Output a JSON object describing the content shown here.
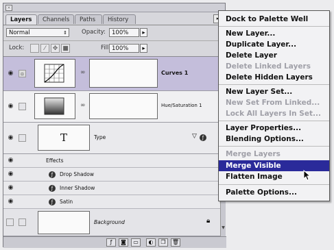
{
  "palette": {
    "tabs": [
      "Layers",
      "Channels",
      "Paths",
      "History"
    ],
    "blend_mode": "Normal",
    "opacity_label": "Opacity:",
    "opacity_value": "100%",
    "lock_label": "Lock:",
    "fill_label": "Fill:",
    "fill_value": "100%"
  },
  "layers": [
    {
      "name": "Curves 1",
      "selected": true
    },
    {
      "name": "Hue/Saturation 1",
      "selected": false
    },
    {
      "name": "Type",
      "thumb": "T",
      "selected": false
    },
    {
      "name": "Background",
      "selected": false
    }
  ],
  "effects": {
    "header": "Effects",
    "items": [
      "Drop Shadow",
      "Inner Shadow",
      "Satin"
    ]
  },
  "menu": {
    "items": [
      {
        "label": "Dock to Palette Well",
        "enabled": true
      },
      {
        "label": "New Layer...",
        "enabled": true
      },
      {
        "label": "Duplicate Layer...",
        "enabled": true
      },
      {
        "label": "Delete Layer",
        "enabled": true
      },
      {
        "label": "Delete Linked Layers",
        "enabled": false
      },
      {
        "label": "Delete Hidden Layers",
        "enabled": true
      },
      {
        "label": "New Layer Set...",
        "enabled": true
      },
      {
        "label": "New Set From Linked...",
        "enabled": false
      },
      {
        "label": "Lock All Layers In Set...",
        "enabled": false
      },
      {
        "label": "Layer Properties...",
        "enabled": true
      },
      {
        "label": "Blending Options...",
        "enabled": true
      },
      {
        "label": "Merge Layers",
        "enabled": false
      },
      {
        "label": "Merge Visible",
        "enabled": true,
        "highlighted": true
      },
      {
        "label": "Flatten Image",
        "enabled": true
      },
      {
        "label": "Palette Options...",
        "enabled": true
      }
    ]
  },
  "colors": {
    "selection": "#c4bedb",
    "menu_highlight": "#2a2a9a"
  }
}
